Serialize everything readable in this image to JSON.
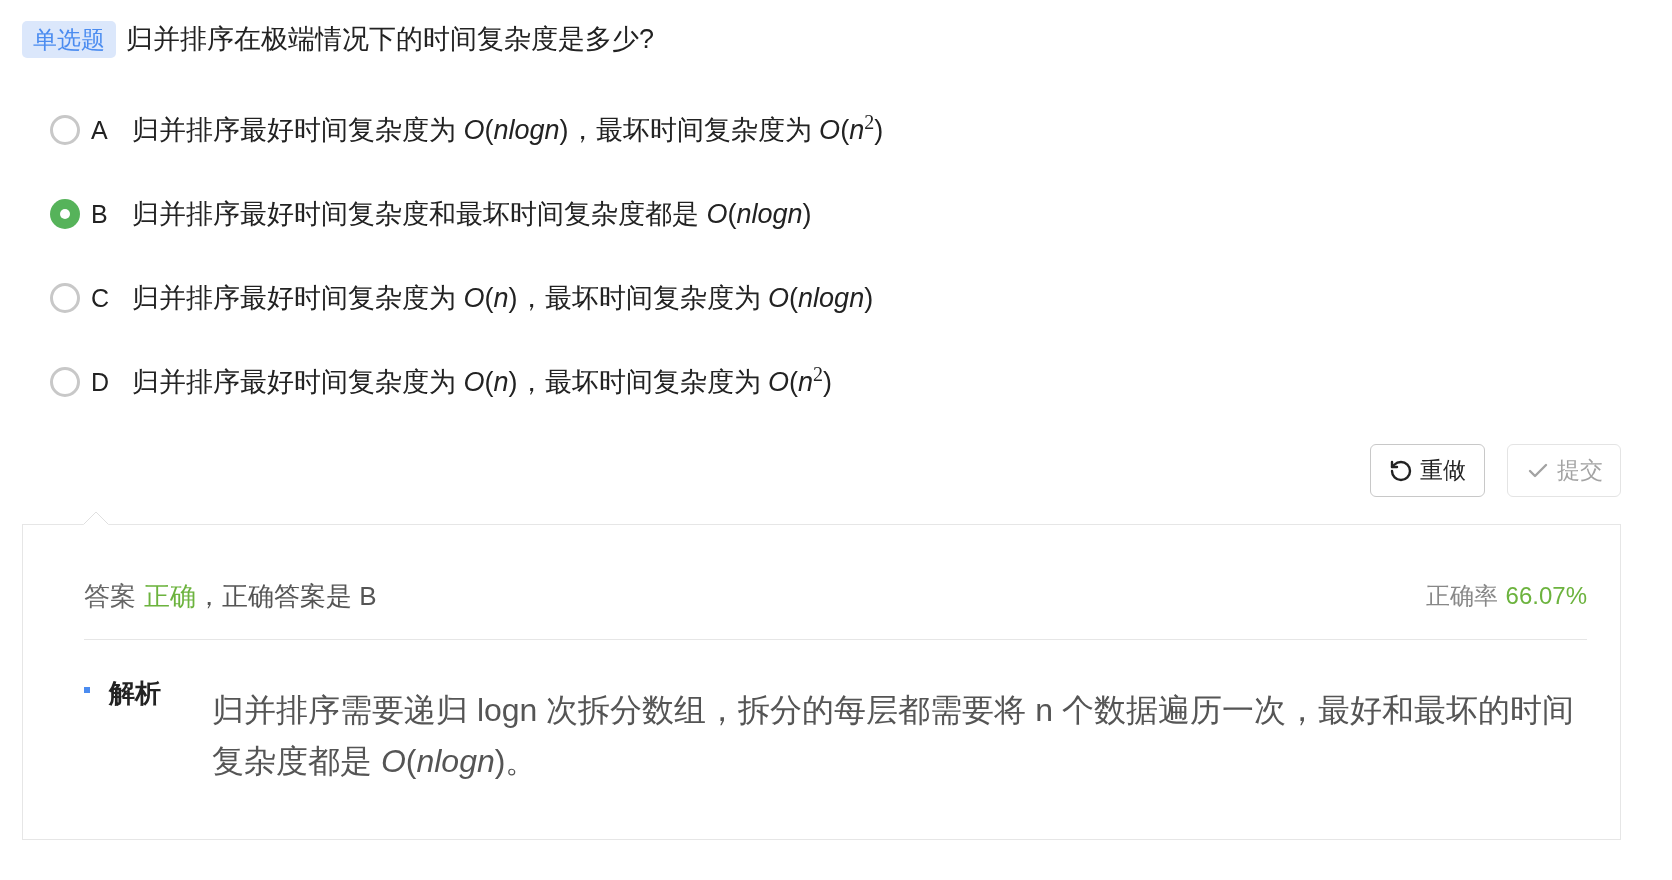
{
  "question": {
    "type_badge": "单选题",
    "text": "归并排序在极端情况下的时间复杂度是多少?"
  },
  "options": [
    {
      "letter": "A",
      "text": "归并排序最好时间复杂度为 *O*(*nlogn*)，最坏时间复杂度为 *O*(*n*$^{2}$)",
      "selected": false
    },
    {
      "letter": "B",
      "text": "归并排序最好时间复杂度和最坏时间复杂度都是 *O*(*nlogn*)",
      "selected": true
    },
    {
      "letter": "C",
      "text": "归并排序最好时间复杂度为 *O*(*n*)，最坏时间复杂度为 *O*(*nlogn*)",
      "selected": false
    },
    {
      "letter": "D",
      "text": "归并排序最好时间复杂度为 *O*(*n*)，最坏时间复杂度为 *O*(*n*$^{2}$)",
      "selected": false
    }
  ],
  "buttons": [
    {
      "kind": "redo",
      "label": "重做",
      "disabled": false
    },
    {
      "kind": "submit",
      "label": "提交",
      "disabled": true
    }
  ],
  "result": {
    "label": "答案",
    "verdict": "正确",
    "verdict_correct": true,
    "detail": "，正确答案是 B",
    "accuracy_label": "正确率",
    "accuracy_value": "66.07%"
  },
  "analysis": {
    "heading": "解析",
    "text": "归并排序需要递归 logn 次拆分数组，拆分的每层都需要将 n 个数据遍历一次，最好和最坏的时间复杂度都是 *O*(*nlogn*)。"
  }
}
